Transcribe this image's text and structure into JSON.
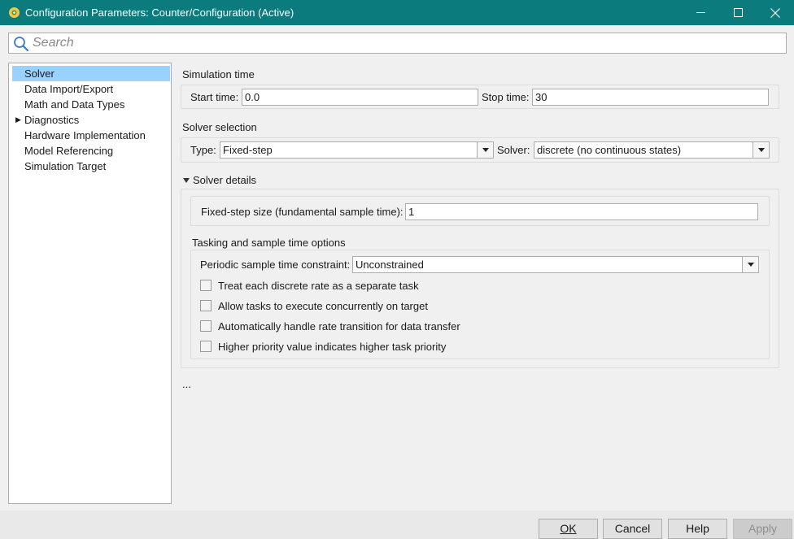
{
  "window": {
    "title": "Configuration Parameters: Counter/Configuration (Active)",
    "accent": "#0b7b7d"
  },
  "search": {
    "placeholder": "Search",
    "value": ""
  },
  "nav": {
    "items": [
      {
        "label": "Solver",
        "selected": true,
        "expandable": false
      },
      {
        "label": "Data Import/Export",
        "selected": false,
        "expandable": false
      },
      {
        "label": "Math and Data Types",
        "selected": false,
        "expandable": false
      },
      {
        "label": "Diagnostics",
        "selected": false,
        "expandable": true
      },
      {
        "label": "Hardware Implementation",
        "selected": false,
        "expandable": false
      },
      {
        "label": "Model Referencing",
        "selected": false,
        "expandable": false
      },
      {
        "label": "Simulation Target",
        "selected": false,
        "expandable": false
      }
    ]
  },
  "simulation_time": {
    "heading": "Simulation time",
    "start_label": "Start time:",
    "start_value": "0.0",
    "stop_label": "Stop time:",
    "stop_value": "30"
  },
  "solver_selection": {
    "heading": "Solver selection",
    "type_label": "Type:",
    "type_value": "Fixed-step",
    "solver_label": "Solver:",
    "solver_value": "discrete (no continuous states)"
  },
  "solver_details": {
    "heading": "Solver details",
    "step_label": "Fixed-step size (fundamental sample time):",
    "step_value": "1",
    "tasking_heading": "Tasking and sample time options",
    "constraint_label": "Periodic sample time constraint:",
    "constraint_value": "Unconstrained",
    "checkboxes": [
      {
        "label": "Treat each discrete rate as a separate task",
        "checked": false
      },
      {
        "label": "Allow tasks to execute concurrently on target",
        "checked": false
      },
      {
        "label": "Automatically handle rate transition for data transfer",
        "checked": false
      },
      {
        "label": "Higher priority value indicates higher task priority",
        "checked": false
      }
    ]
  },
  "more": "...",
  "buttons": {
    "ok": "OK",
    "cancel": "Cancel",
    "help": "Help",
    "apply": "Apply"
  }
}
